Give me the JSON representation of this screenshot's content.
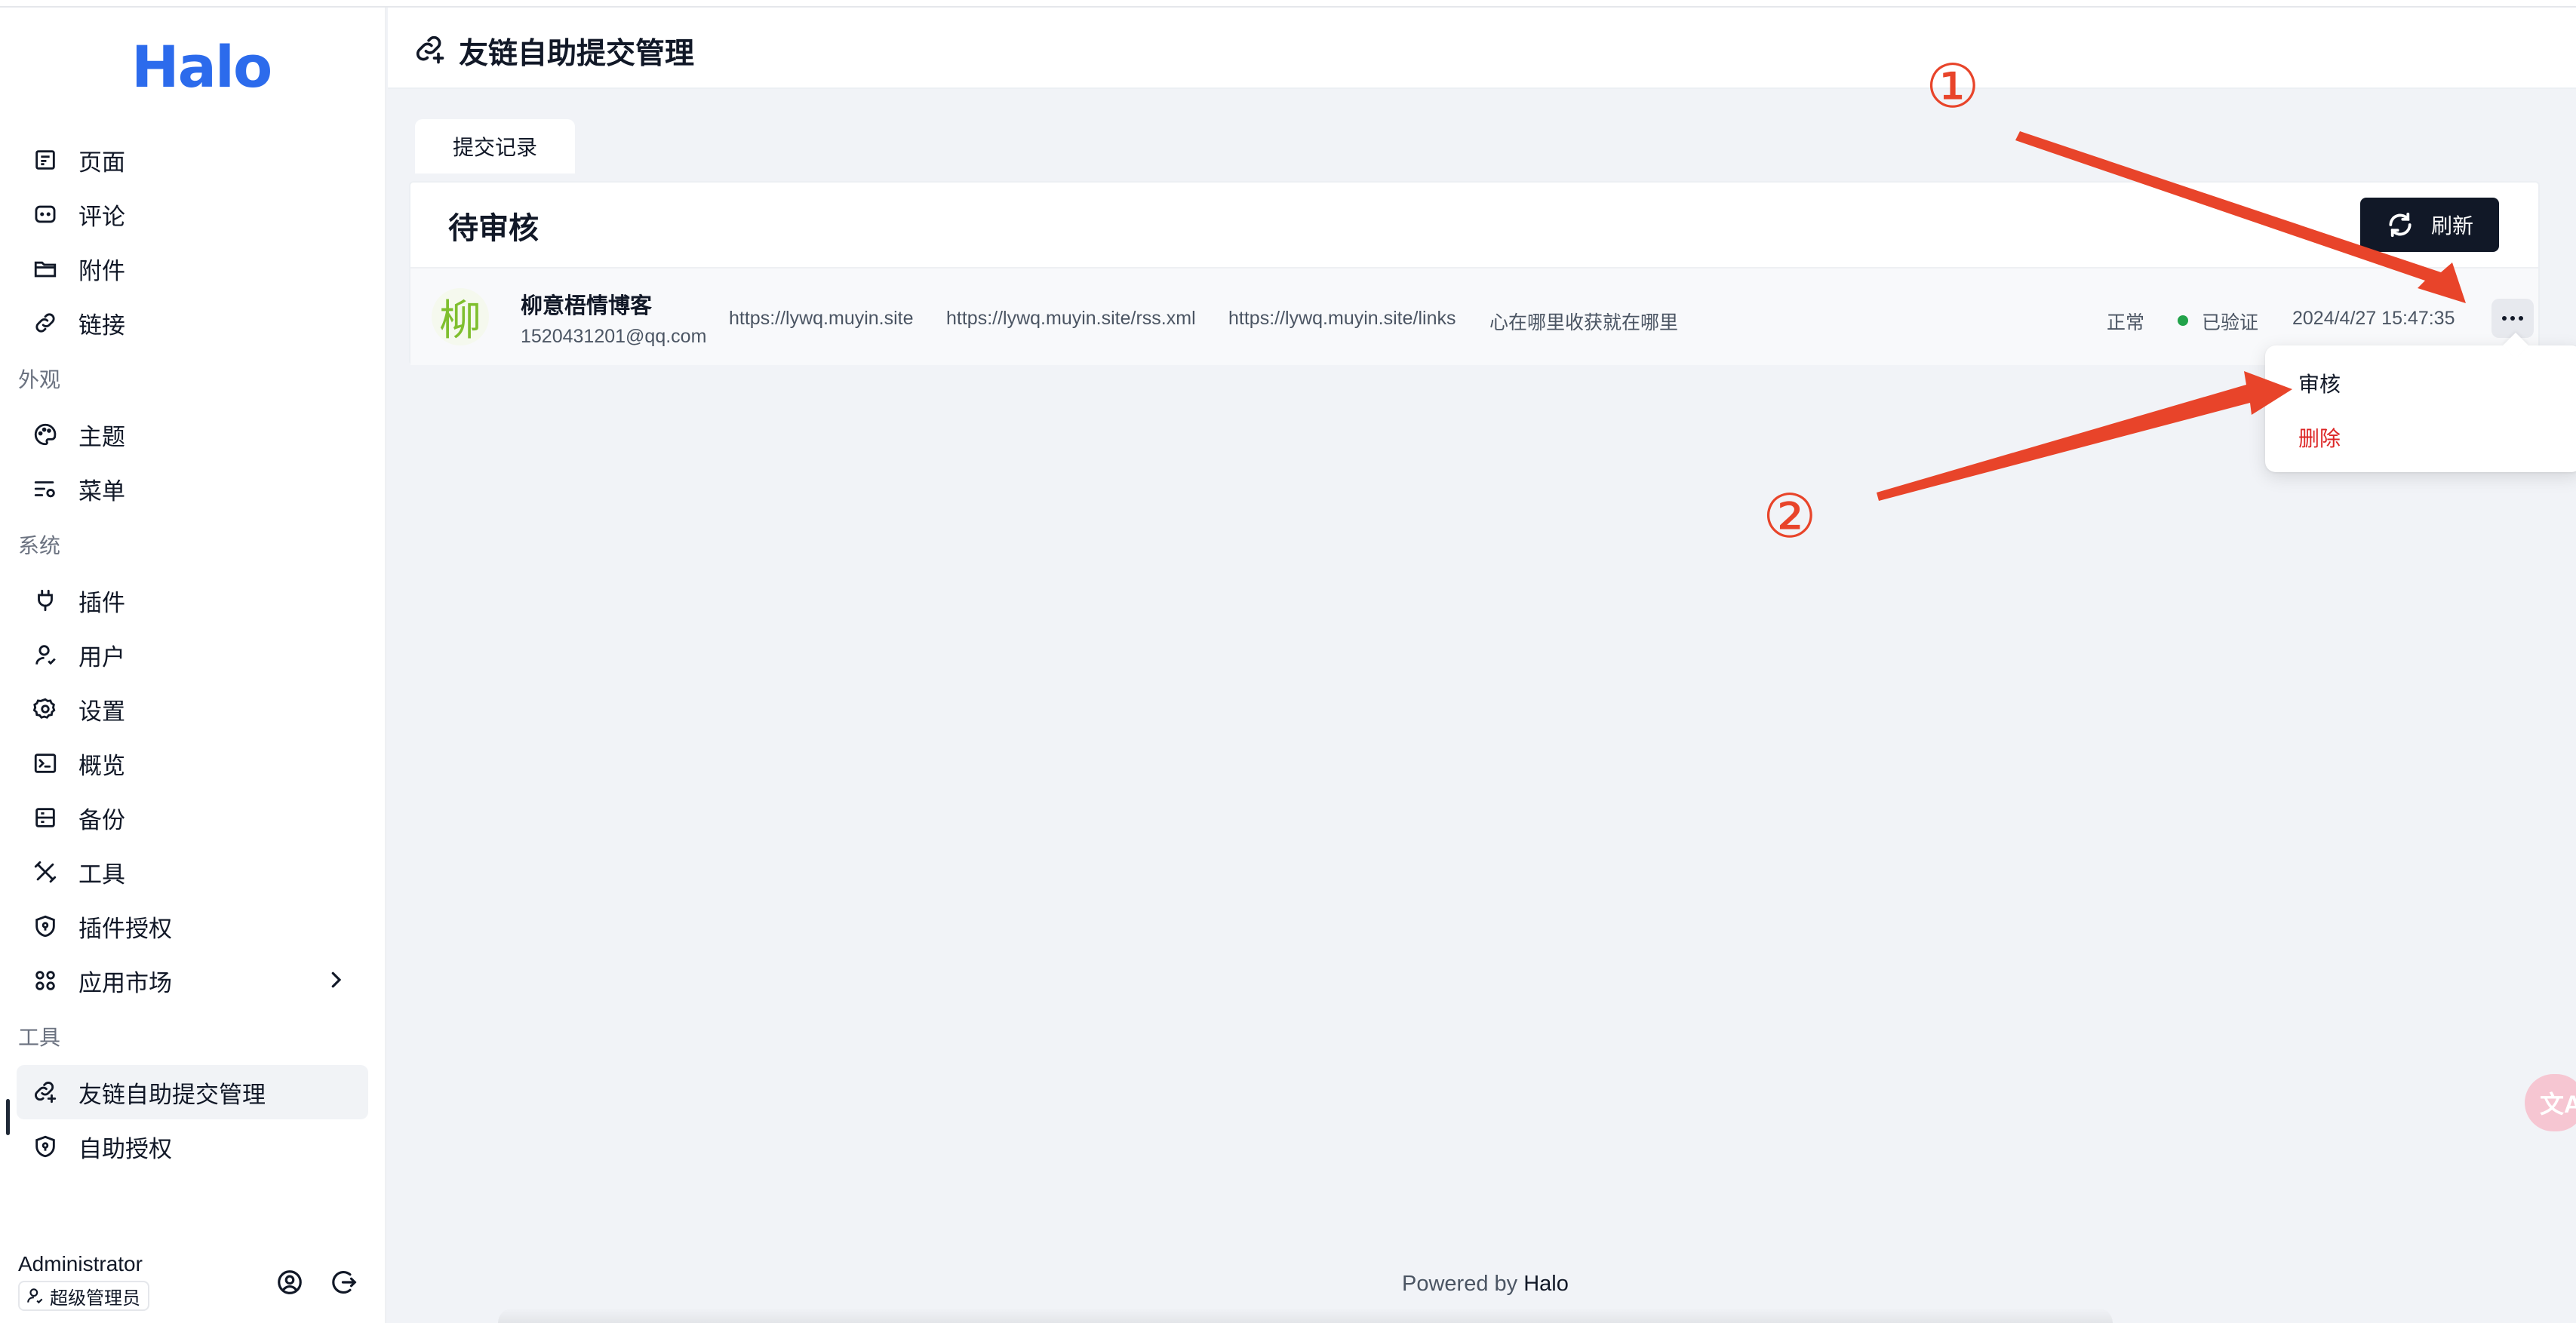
{
  "app": {
    "logo": "Halo",
    "accent_color": "#2c6bec",
    "annotation_color": "#e8442a"
  },
  "sidebar": {
    "items": [
      {
        "label": "页面",
        "icon": "page-icon"
      },
      {
        "label": "评论",
        "icon": "comment-icon"
      },
      {
        "label": "附件",
        "icon": "folder-icon"
      },
      {
        "label": "链接",
        "icon": "link-icon"
      }
    ],
    "groups": [
      {
        "title": "外观",
        "items": [
          {
            "label": "主题",
            "icon": "palette-icon"
          },
          {
            "label": "菜单",
            "icon": "menu-settings-icon"
          }
        ]
      },
      {
        "title": "系统",
        "items": [
          {
            "label": "插件",
            "icon": "plug-icon"
          },
          {
            "label": "用户",
            "icon": "user-icon"
          },
          {
            "label": "设置",
            "icon": "gear-icon"
          },
          {
            "label": "概览",
            "icon": "terminal-icon"
          },
          {
            "label": "备份",
            "icon": "backup-icon"
          },
          {
            "label": "工具",
            "icon": "tools-icon"
          },
          {
            "label": "插件授权",
            "icon": "shield-icon"
          },
          {
            "label": "应用市场",
            "icon": "apps-icon"
          }
        ]
      },
      {
        "title": "工具",
        "items": [
          {
            "label": "友链自助提交管理",
            "icon": "link-add-icon",
            "active": true
          },
          {
            "label": "自助授权",
            "icon": "shield-icon"
          }
        ]
      }
    ],
    "user": {
      "name": "Administrator",
      "role": "超级管理员"
    }
  },
  "header": {
    "title": "友链自助提交管理"
  },
  "tabs": [
    {
      "label": "提交记录",
      "active": true
    }
  ],
  "card": {
    "title": "待审核",
    "refresh_label": "刷新"
  },
  "submission": {
    "avatar_char": "柳",
    "name": "柳意梧情博客",
    "email": "1520431201@qq.com",
    "site_url": "https://lywq.muyin.site",
    "rss_url": "https://lywq.muyin.site/rss.xml",
    "links_url": "https://lywq.muyin.site/links",
    "description": "心在哪里收获就在哪里",
    "status": "正常",
    "verification": "已验证",
    "verification_color": "#22a34a",
    "timestamp": "2024/4/27 15:47:35"
  },
  "dropdown": {
    "items": [
      {
        "label": "审核",
        "color": "#111827"
      },
      {
        "label": "删除",
        "color": "#dc2626"
      }
    ]
  },
  "annotations": {
    "marker_1": "①",
    "marker_2": "②"
  },
  "footer": {
    "prefix": "Powered by",
    "brand": "Halo"
  },
  "translate_bubble": {
    "text": "文A"
  }
}
